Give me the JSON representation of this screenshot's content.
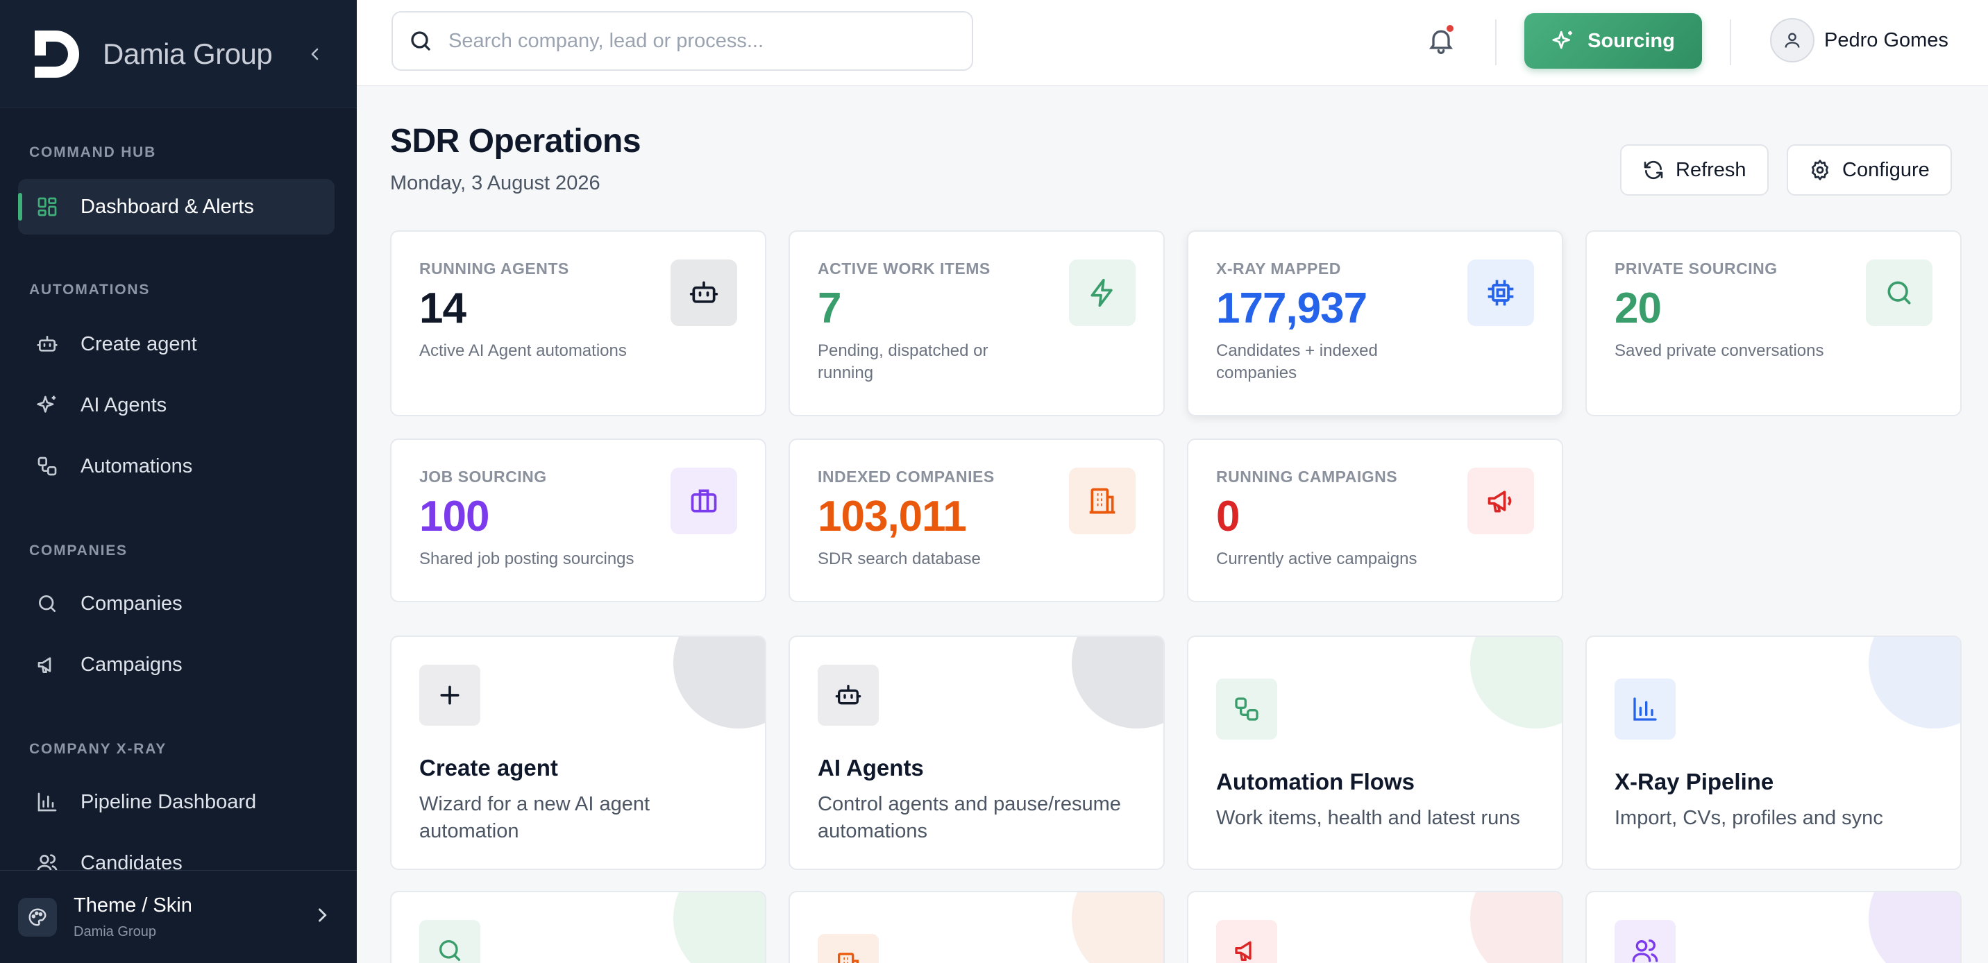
{
  "brand": {
    "name": "Damia Group"
  },
  "sidebar": {
    "sections": [
      {
        "title": "COMMAND HUB"
      },
      {
        "title": "AUTOMATIONS"
      },
      {
        "title": "COMPANIES"
      },
      {
        "title": "COMPANY X-RAY"
      }
    ],
    "items": [
      {
        "label": "Dashboard & Alerts",
        "icon": "grid-icon",
        "active": true
      },
      {
        "label": "Create agent",
        "icon": "robot-icon"
      },
      {
        "label": "AI Agents",
        "icon": "sparkles-icon"
      },
      {
        "label": "Automations",
        "icon": "workflow-icon"
      },
      {
        "label": "Companies",
        "icon": "search-icon"
      },
      {
        "label": "Campaigns",
        "icon": "megaphone-icon"
      },
      {
        "label": "Pipeline Dashboard",
        "icon": "bar-chart-icon"
      },
      {
        "label": "Candidates",
        "icon": "users-icon"
      }
    ],
    "footer": {
      "title": "Theme / Skin",
      "subtitle": "Damia Group"
    }
  },
  "topbar": {
    "search_placeholder": "Search company, lead or process...",
    "sourcing_label": "Sourcing",
    "user_name": "Pedro Gomes"
  },
  "page": {
    "title": "SDR Operations",
    "date": "Monday, 3 August 2026",
    "refresh_label": "Refresh",
    "configure_label": "Configure"
  },
  "stats": [
    {
      "label": "RUNNING AGENTS",
      "value": "14",
      "sub": "Active AI Agent automations",
      "color": "#111827"
    },
    {
      "label": "ACTIVE WORK ITEMS",
      "value": "7",
      "sub": "Pending, dispatched or running",
      "color": "#3a9d6c"
    },
    {
      "label": "X-RAY MAPPED",
      "value": "177,937",
      "sub": "Candidates + indexed companies",
      "color": "#2563eb"
    },
    {
      "label": "PRIVATE SOURCING",
      "value": "20",
      "sub": "Saved private conversations",
      "color": "#3a9d6c"
    },
    {
      "label": "JOB SOURCING",
      "value": "100",
      "sub": "Shared job posting sourcings",
      "color": "#7c3aed"
    },
    {
      "label": "INDEXED COMPANIES",
      "value": "103,011",
      "sub": "SDR search database",
      "color": "#ea580c"
    },
    {
      "label": "RUNNING CAMPAIGNS",
      "value": "0",
      "sub": "Currently active campaigns",
      "color": "#dc2626"
    }
  ],
  "cards": [
    {
      "title": "Create agent",
      "desc": "Wizard for a new AI agent automation"
    },
    {
      "title": "AI Agents",
      "desc": "Control agents and pause/resume automations"
    },
    {
      "title": "Automation Flows",
      "desc": "Work items, health and latest runs"
    },
    {
      "title": "X-Ray Pipeline",
      "desc": "Import, CVs, profiles and sync"
    }
  ]
}
